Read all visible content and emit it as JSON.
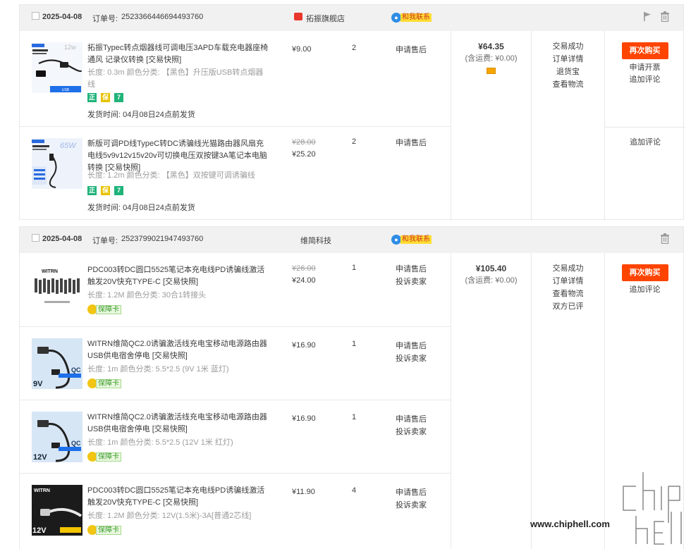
{
  "orders": [
    {
      "date": "2025-04-08",
      "order_no_label": "订单号:",
      "order_no": "2523366446694493760",
      "shop": "拓振旗舰店",
      "contact": "和我联系",
      "total": "¥64.35",
      "shipping_fee": "(含运费: ¥0.00)",
      "status": [
        "交易成功",
        "订单详情",
        "退货宝",
        "查看物流"
      ],
      "actions": {
        "buy_again": "再次购买",
        "invoice": "申请开票",
        "review": "追加评论"
      },
      "items": [
        {
          "title": "拓振Typec转点烟器线可调电压3APD车载充电器座椅通风 记录仪转换",
          "snapshot": "[交易快照]",
          "spec": "长度: 0.3m  颜色分类: 【黑色】升压版USB转点烟器线",
          "unit_price": "¥9.00",
          "qty": "2",
          "after_sale": [
            "申请售后"
          ],
          "ship_time": "发货时间: 04月08日24点前发货",
          "badges": [
            "正",
            "保",
            "7"
          ]
        },
        {
          "title": "新版可调PD线TypeC转DC诱骗线光猫路由器风扇充电线5v9v12v15v20v可切换电压双按键3A笔记本电脑转换",
          "snapshot": "[交易快照]",
          "spec": "长度: 1.2m  颜色分类: 【黑色】双按键可调诱骗线",
          "orig_price": "¥28.00",
          "unit_price": "¥25.20",
          "qty": "2",
          "after_sale": [
            "申请售后"
          ],
          "ship_time": "发货时间: 04月08日24点前发货",
          "badges": [
            "正",
            "保",
            "7"
          ],
          "review": "追加评论"
        }
      ]
    },
    {
      "date": "2025-04-08",
      "order_no_label": "订单号:",
      "order_no": "2523799021947493760",
      "shop": "维简科技",
      "contact": "和我联系",
      "total": "¥105.40",
      "shipping_fee": "(含运费: ¥0.00)",
      "status": [
        "交易成功",
        "订单详情",
        "查看物流",
        "双方已评"
      ],
      "actions": {
        "buy_again": "再次购买",
        "review": "追加评论"
      },
      "items": [
        {
          "title": "PDC003转DC圆口5525笔记本充电线PD诱骗线激活触发20V快充TYPE-C",
          "snapshot": "[交易快照]",
          "spec": "长度: 1.2M  颜色分类: 30合1转接头",
          "orig_price": "¥26.00",
          "unit_price": "¥24.00",
          "qty": "1",
          "after_sale": [
            "申请售后",
            "投诉卖家"
          ],
          "guard": "保障卡"
        },
        {
          "title": "WITRN维简QC2.0诱骗激活线充电宝移动电源路由器USB供电宿舍停电",
          "snapshot": "[交易快照]",
          "spec": "长度: 1m  颜色分类: 5.5*2.5 (9V 1米 蓝灯)",
          "unit_price": "¥16.90",
          "qty": "1",
          "after_sale": [
            "申请售后",
            "投诉卖家"
          ],
          "guard": "保障卡",
          "thumb_label": "9V",
          "thumb_sub": "QC"
        },
        {
          "title": "WITRN维简QC2.0诱骗激活线充电宝移动电源路由器USB供电宿舍停电",
          "snapshot": "[交易快照]",
          "spec": "长度: 1m  颜色分类: 5.5*2.5 (12V 1米 红灯)",
          "unit_price": "¥16.90",
          "qty": "1",
          "after_sale": [
            "申请售后",
            "投诉卖家"
          ],
          "guard": "保障卡",
          "thumb_label": "12V",
          "thumb_sub": "QC"
        },
        {
          "title": "PDC003转DC圆口5525笔记本充电线PD诱骗线激活触发20V快充TYPE-C",
          "snapshot": "[交易快照]",
          "spec": "长度: 1.2M  颜色分类: 12V(1.5米)-3A[普通2芯线]",
          "unit_price": "¥11.90",
          "qty": "4",
          "after_sale": [
            "申请售后",
            "投诉卖家"
          ],
          "guard": "保障卡",
          "thumb_label": "12V",
          "thumb_brand": "WITRN"
        }
      ]
    }
  ],
  "watermark": "www.chiphell.com",
  "colors": {
    "buy_button": "#ff4400",
    "header_bg": "#f1f1f1",
    "contact_bg": "#ffdd33",
    "badge_green": "#1fb37a",
    "badge_yellow": "#e7c200"
  }
}
